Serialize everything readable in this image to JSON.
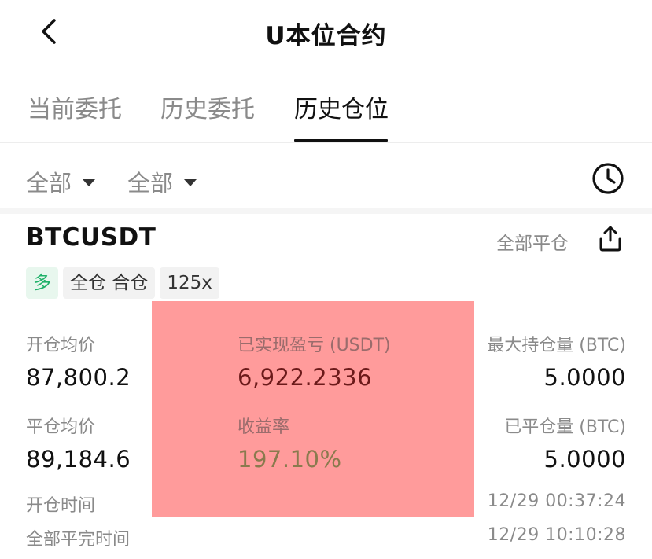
{
  "header": {
    "title": "U本位合约"
  },
  "tabs": [
    {
      "label": "当前委托",
      "active": false
    },
    {
      "label": "历史委托",
      "active": false
    },
    {
      "label": "历史仓位",
      "active": true
    }
  ],
  "filters": [
    {
      "label": "全部"
    },
    {
      "label": "全部"
    }
  ],
  "icons": {
    "back": "chevron-left-icon",
    "history": "clock-icon",
    "share": "share-icon",
    "dropdown": "caret-down-icon"
  },
  "position": {
    "symbol": "BTCUSDT",
    "close_all_label": "全部平仓",
    "tags": {
      "side": "多",
      "margin_mode": "全仓 合仓",
      "leverage": "125x"
    },
    "open_avg_label": "开仓均价",
    "open_avg_value": "87,800.2",
    "pnl_label": "已实现盈亏 (USDT)",
    "pnl_value": "6,922.2336",
    "max_hold_label": "最大持仓量 (BTC)",
    "max_hold_value": "5.0000",
    "close_avg_label": "平仓均价",
    "close_avg_value": "89,184.6",
    "roi_label": "收益率",
    "roi_value": "197.10%",
    "closed_qty_label": "已平仓量 (BTC)",
    "closed_qty_value": "5.0000",
    "open_time_label": "开仓时间",
    "open_time_value": "12/29 00:37:24",
    "close_time_label": "全部平完时间",
    "close_time_value": "12/29 10:10:28"
  },
  "colors": {
    "long": "#21b26a",
    "redaction": "#ff9b9b",
    "text_secondary": "#8a8a8a"
  }
}
